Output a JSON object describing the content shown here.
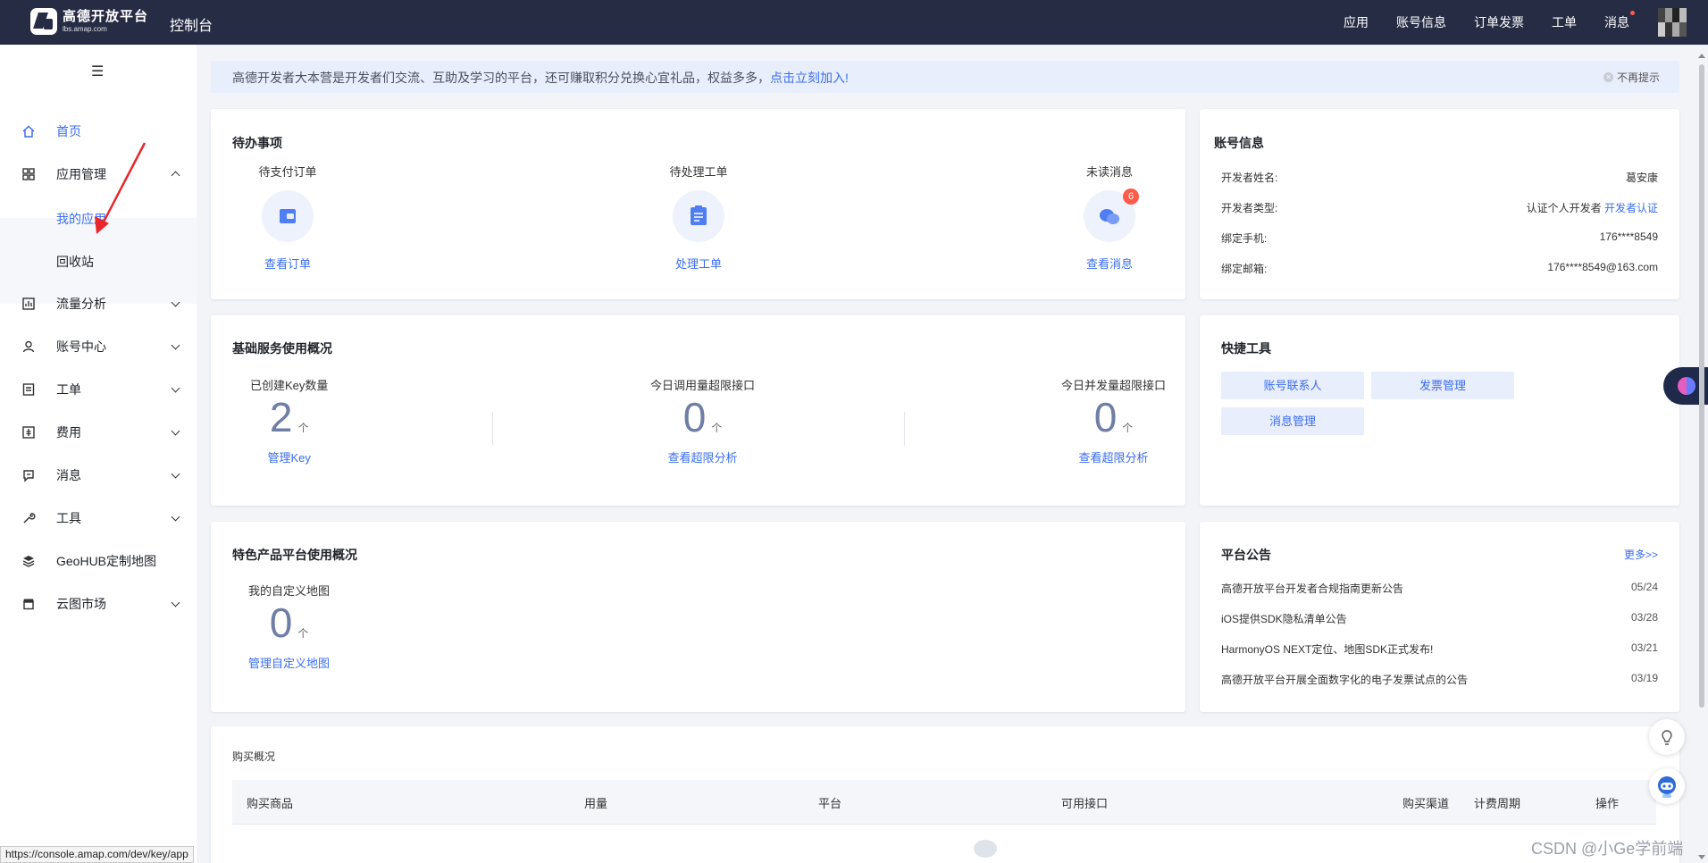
{
  "header": {
    "logo_cn": "高德开放平台",
    "logo_en": "lbs.amap.com",
    "console_title": "控制台",
    "nav": [
      "应用",
      "账号信息",
      "订单发票",
      "工单",
      "消息"
    ]
  },
  "sidebar": {
    "items": [
      {
        "label": "首页",
        "icon": "home-icon"
      },
      {
        "label": "应用管理",
        "icon": "grid-icon"
      },
      {
        "label": "流量分析",
        "icon": "chart-icon"
      },
      {
        "label": "账号中心",
        "icon": "user-icon"
      },
      {
        "label": "工单",
        "icon": "ticket-icon"
      },
      {
        "label": "费用",
        "icon": "money-icon"
      },
      {
        "label": "消息",
        "icon": "message-icon"
      },
      {
        "label": "工具",
        "icon": "wrench-icon"
      },
      {
        "label": "GeoHUB定制地图",
        "icon": "layers-icon"
      },
      {
        "label": "云图市场",
        "icon": "store-icon"
      }
    ],
    "sub_items": [
      "我的应用",
      "回收站"
    ]
  },
  "status_url": "https://console.amap.com/dev/key/app",
  "notice": {
    "text": "高德开发者大本营是开发者们交流、互助及学习的平台，还可赚取积分兑换心宜礼品，权益多多，",
    "link": "点击立刻加入!",
    "dismiss": "不再提示"
  },
  "todo": {
    "title": "待办事项",
    "items": [
      {
        "label": "待支付订单",
        "link": "查看订单"
      },
      {
        "label": "待处理工单",
        "link": "处理工单"
      },
      {
        "label": "未读消息",
        "link": "查看消息",
        "badge": "6"
      }
    ]
  },
  "account": {
    "title": "账号信息",
    "rows": [
      {
        "key": "开发者姓名:",
        "value": "葛安康"
      },
      {
        "key": "开发者类型:",
        "value": "认证个人开发者",
        "link": "开发者认证"
      },
      {
        "key": "绑定手机:",
        "value": "176****8549"
      },
      {
        "key": "绑定邮箱:",
        "value": "176****8549@163.com"
      }
    ]
  },
  "basic": {
    "title": "基础服务使用概况",
    "stats": [
      {
        "label": "已创建Key数量",
        "value": "2",
        "unit": "个",
        "link": "管理Key"
      },
      {
        "label": "今日调用量超限接口",
        "value": "0",
        "unit": "个",
        "link": "查看超限分析"
      },
      {
        "label": "今日并发量超限接口",
        "value": "0",
        "unit": "个",
        "link": "查看超限分析"
      }
    ]
  },
  "quick": {
    "title": "快捷工具",
    "buttons": [
      "账号联系人",
      "发票管理",
      "消息管理"
    ]
  },
  "special": {
    "title": "特色产品平台使用概况",
    "stat": {
      "label": "我的自定义地图",
      "value": "0",
      "unit": "个",
      "link": "管理自定义地图"
    }
  },
  "announcements": {
    "title": "平台公告",
    "more": "更多>>",
    "items": [
      {
        "title": "高德开放平台开发者合规指南更新公告",
        "date": "05/24"
      },
      {
        "title": "iOS提供SDK隐私清单公告",
        "date": "03/28"
      },
      {
        "title": "HarmonyOS NEXT定位、地图SDK正式发布!",
        "date": "03/21"
      },
      {
        "title": "高德开放平台开展全面数字化的电子发票试点的公告",
        "date": "03/19"
      }
    ]
  },
  "purchase": {
    "title": "购买概况",
    "columns": [
      "购买商品",
      "用量",
      "平台",
      "可用接口",
      "购买渠道",
      "计费周期",
      "操作"
    ]
  },
  "watermark": "CSDN @小Ge学前端",
  "colors": {
    "header_bg": "#272c45",
    "accent": "#3a6df0",
    "badge": "#ff5a4a"
  }
}
